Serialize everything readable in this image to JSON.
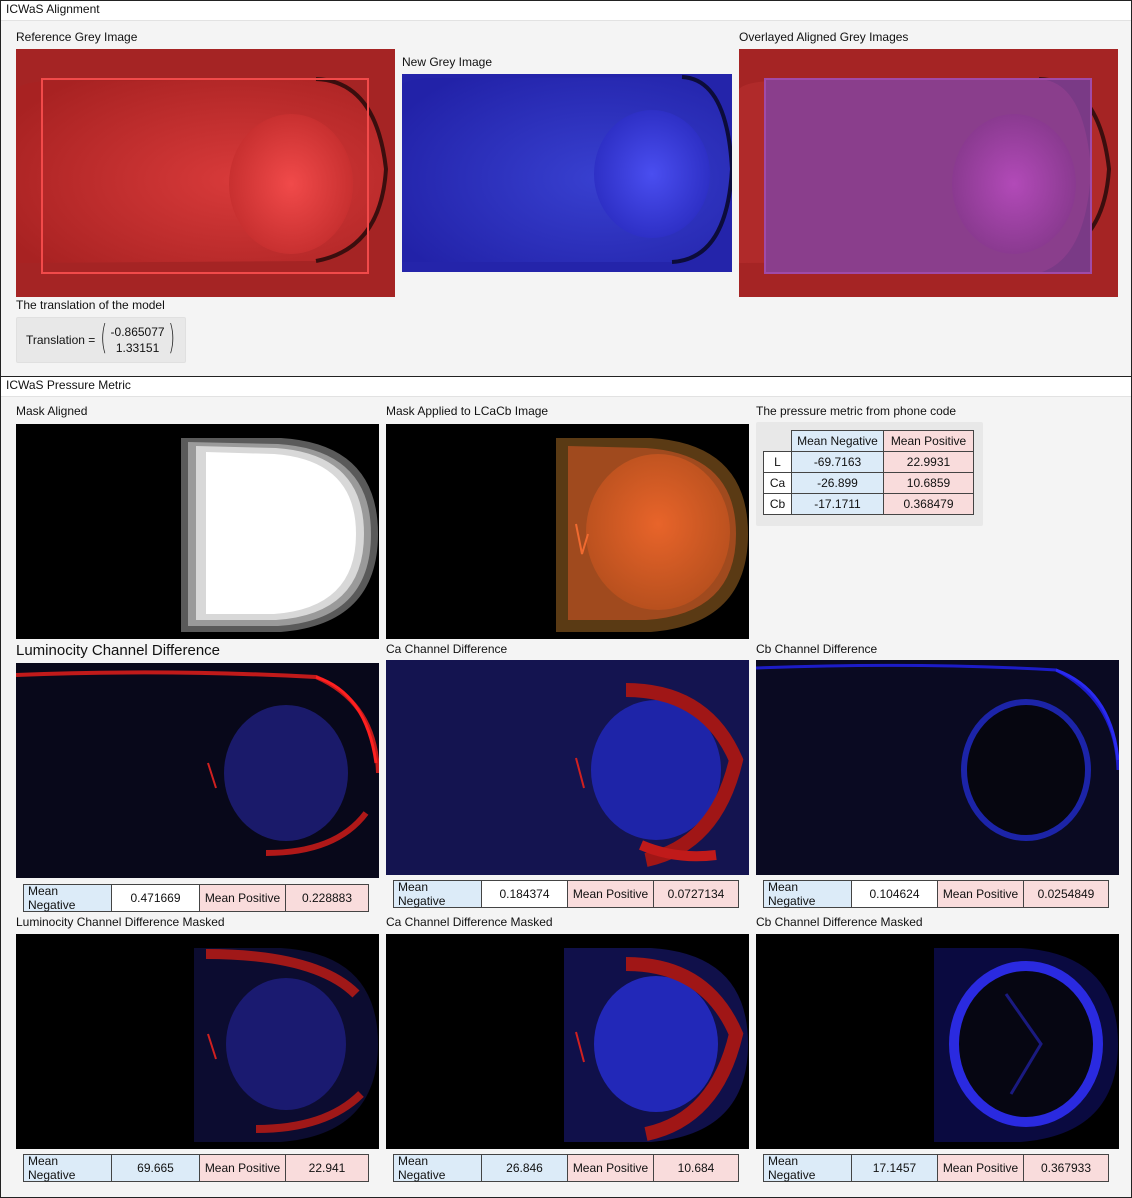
{
  "alignment": {
    "title": "ICWaS Alignment",
    "reference_label": "Reference Grey Image",
    "new_label": "New Grey Image",
    "overlay_label": "Overlayed Aligned Grey Images",
    "translation_caption": "The translation of the model",
    "translation_prefix": "Translation =",
    "translation_x": "-0.865077",
    "translation_y": "1.33151"
  },
  "pressure": {
    "title": "ICWaS Pressure Metric",
    "mask_aligned_label": "Mask Aligned",
    "mask_applied_label": "Mask Applied to LCaCb Image",
    "metric_label": "The pressure metric from phone code",
    "metric_table": {
      "headers": [
        "Mean Negative",
        "Mean Positive"
      ],
      "rows": [
        {
          "channel": "L",
          "neg": "-69.7163",
          "pos": "22.9931"
        },
        {
          "channel": "Ca",
          "neg": "-26.899",
          "pos": "10.6859"
        },
        {
          "channel": "Cb",
          "neg": "-17.1711",
          "pos": "0.368479"
        }
      ]
    },
    "neg_label": "Mean Negative",
    "pos_label": "Mean Positive",
    "diff": [
      {
        "label": "Luminocity Channel Difference",
        "neg": "0.471669",
        "pos": "0.228883"
      },
      {
        "label": "Ca Channel Difference",
        "neg": "0.184374",
        "pos": "0.0727134"
      },
      {
        "label": "Cb Channel Difference",
        "neg": "0.104624",
        "pos": "0.0254849"
      }
    ],
    "masked": [
      {
        "label": "Luminocity Channel Difference Masked",
        "neg": "69.665",
        "pos": "22.941"
      },
      {
        "label": "Ca Channel Difference Masked",
        "neg": "26.846",
        "pos": "10.684"
      },
      {
        "label": "Cb Channel Difference Masked",
        "neg": "17.1457",
        "pos": "0.367933"
      }
    ]
  },
  "colors": {
    "reference_tint": "#b52a2a",
    "new_tint": "#2a2ab8",
    "overlay_tint": "#8a3a7a",
    "neg_bg": "#dcebf8",
    "pos_bg": "#f9dcdc"
  }
}
